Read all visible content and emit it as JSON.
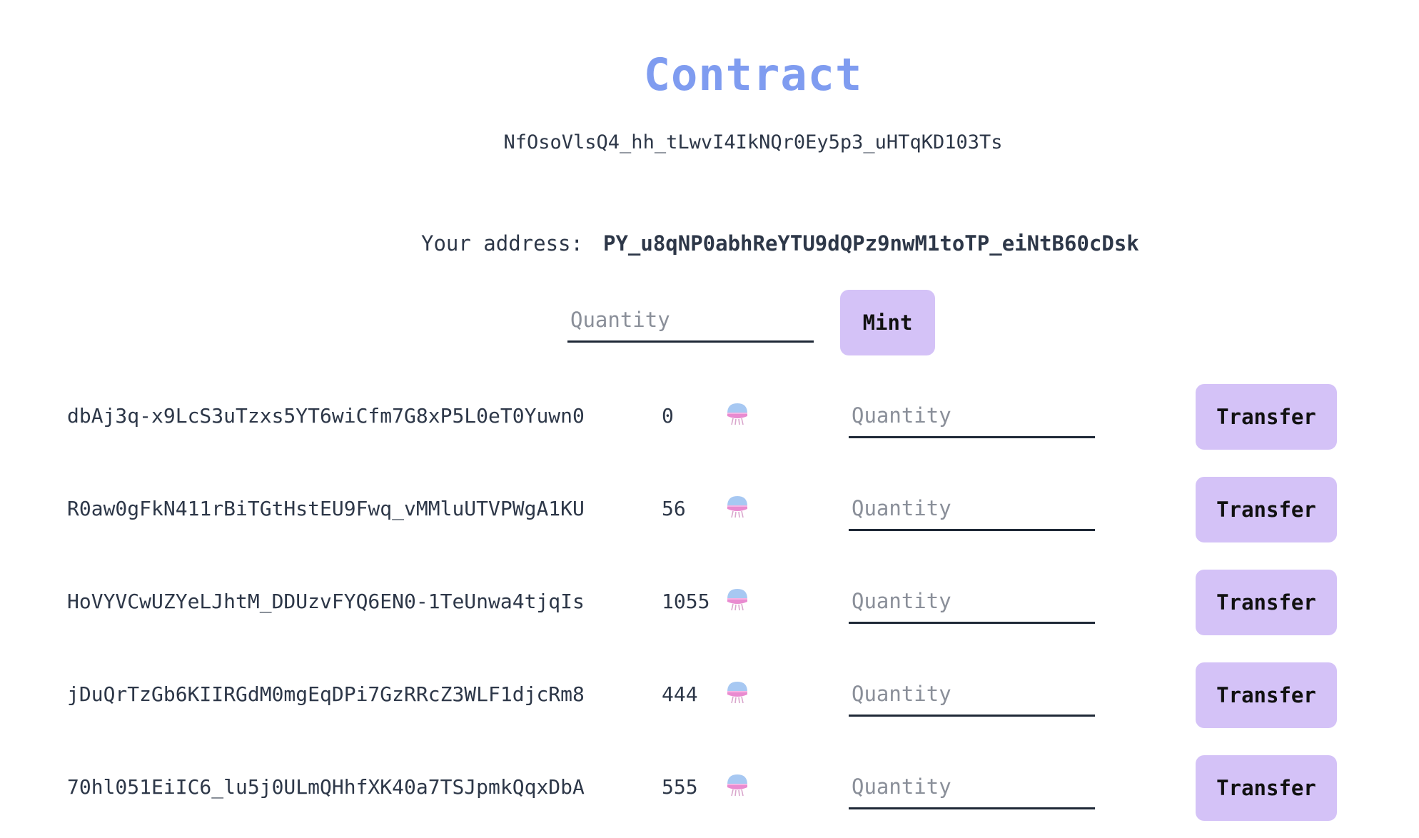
{
  "header": {
    "title": "Contract",
    "contract_id": "NfOsoVlsQ4_hh_tLwvI4IkNQr0Ey5p3_uHTqKD103Ts"
  },
  "account": {
    "label": "Your address:",
    "address": "PY_u8qNP0abhReYTU9dQPz9nwM1toTP_eiNtB60cDsk"
  },
  "mint": {
    "quantity_placeholder": "Quantity",
    "quantity_value": "",
    "button_label": "Mint"
  },
  "token_icon": "jellyfish-icon",
  "colors": {
    "title": "#7f9cf0",
    "button_bg": "#d4c2f7"
  },
  "holders": [
    {
      "address": "dbAj3q-x9LcS3uTzxs5YT6wiCfm7G8xP5L0eT0Yuwn0",
      "balance": "0",
      "quantity_placeholder": "Quantity",
      "button_label": "Transfer"
    },
    {
      "address": "R0aw0gFkN411rBiTGtHstEU9Fwq_vMMluUTVPWgA1KU",
      "balance": "56",
      "quantity_placeholder": "Quantity",
      "button_label": "Transfer"
    },
    {
      "address": "HoVYVCwUZYeLJhtM_DDUzvFYQ6EN0-1TeUnwa4tjqIs",
      "balance": "1055",
      "quantity_placeholder": "Quantity",
      "button_label": "Transfer"
    },
    {
      "address": "jDuQrTzGb6KIIRGdM0mgEqDPi7GzRRcZ3WLF1djcRm8",
      "balance": "444",
      "quantity_placeholder": "Quantity",
      "button_label": "Transfer"
    },
    {
      "address": "70hl051EiIC6_lu5j0ULmQHhfXK40a7TSJpmkQqxDbA",
      "balance": "555",
      "quantity_placeholder": "Quantity",
      "button_label": "Transfer"
    }
  ]
}
